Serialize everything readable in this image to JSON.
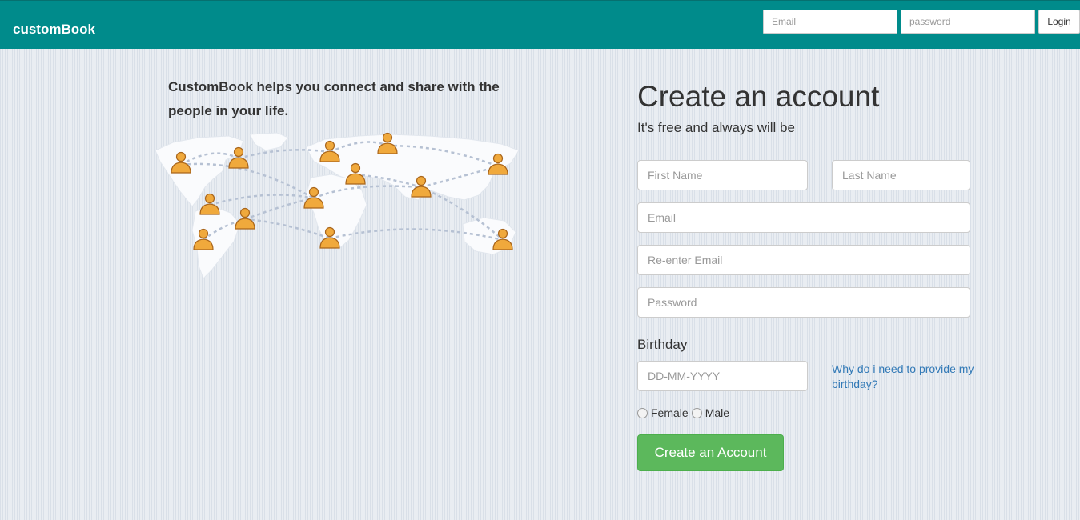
{
  "navbar": {
    "brand": "customBook",
    "email_placeholder": "Email",
    "password_placeholder": "password",
    "login_label": "Login"
  },
  "intro": {
    "tagline": "CustomBook helps you connect and share with the people in your life."
  },
  "signup": {
    "heading": "Create an account",
    "subheading": "It's free and always will be",
    "first_name_placeholder": "First Name",
    "last_name_placeholder": "Last Name",
    "email_placeholder": "Email",
    "reenter_email_placeholder": "Re-enter Email",
    "password_placeholder": "Password",
    "birthday_label": "Birthday",
    "birthday_placeholder": "DD-MM-YYYY",
    "why_birthday_link": "Why do i need to provide my birthday?",
    "gender_female": "Female",
    "gender_male": "Male",
    "submit_label": "Create an Account"
  },
  "colors": {
    "navbar": "#008b8b",
    "button_success": "#5cb85c",
    "link": "#337ab7",
    "person_icon": "#f0a93c"
  }
}
